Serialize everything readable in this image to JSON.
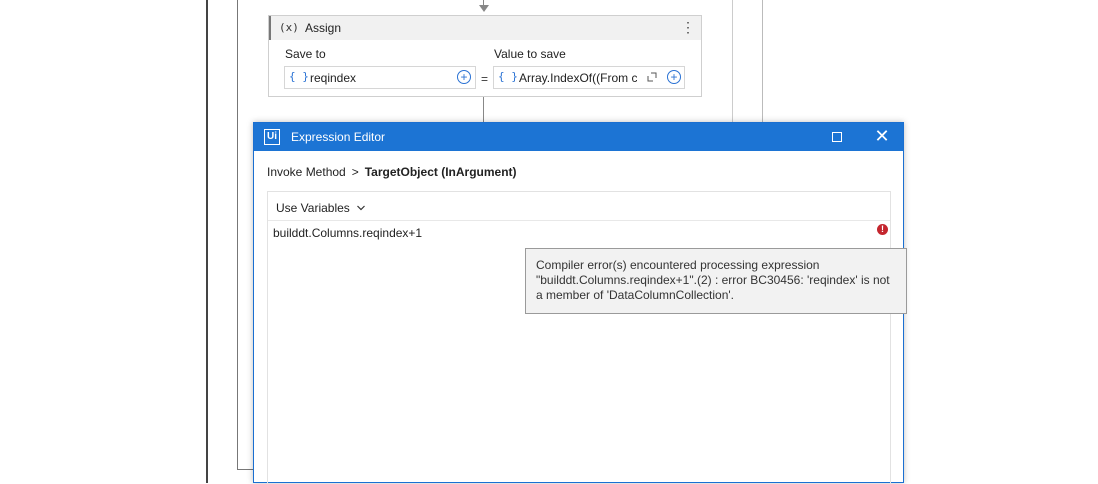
{
  "assign": {
    "icon": "(x)",
    "title": "Assign",
    "kebab": "⋮",
    "save_to_label": "Save to",
    "value_label": "Value to save",
    "save_to_value": "reqindex",
    "value_to_save": "Array.IndexOf((From c",
    "equals": "=",
    "brace": "{ }"
  },
  "dialog": {
    "logo": "Ui",
    "title": "Expression Editor",
    "breadcrumb_parent": "Invoke Method",
    "breadcrumb_sep": ">",
    "breadcrumb_current": "TargetObject (InArgument)",
    "use_variables": "Use Variables",
    "expression": "builddt.Columns.reqindex+1",
    "error_tooltip": "Compiler error(s) encountered processing expression \"builddt.Columns.reqindex+1\".(2) : error BC30456: 'reqindex' is not a member of 'DataColumnCollection'."
  },
  "icons": {
    "expand": "expand-icon",
    "add": "plus-circle-icon",
    "error": "error-icon",
    "chevron": "chevron-down-icon"
  },
  "colors": {
    "titlebar": "#1c74d4",
    "accent": "#2a72d4",
    "error": "#c4262e"
  }
}
